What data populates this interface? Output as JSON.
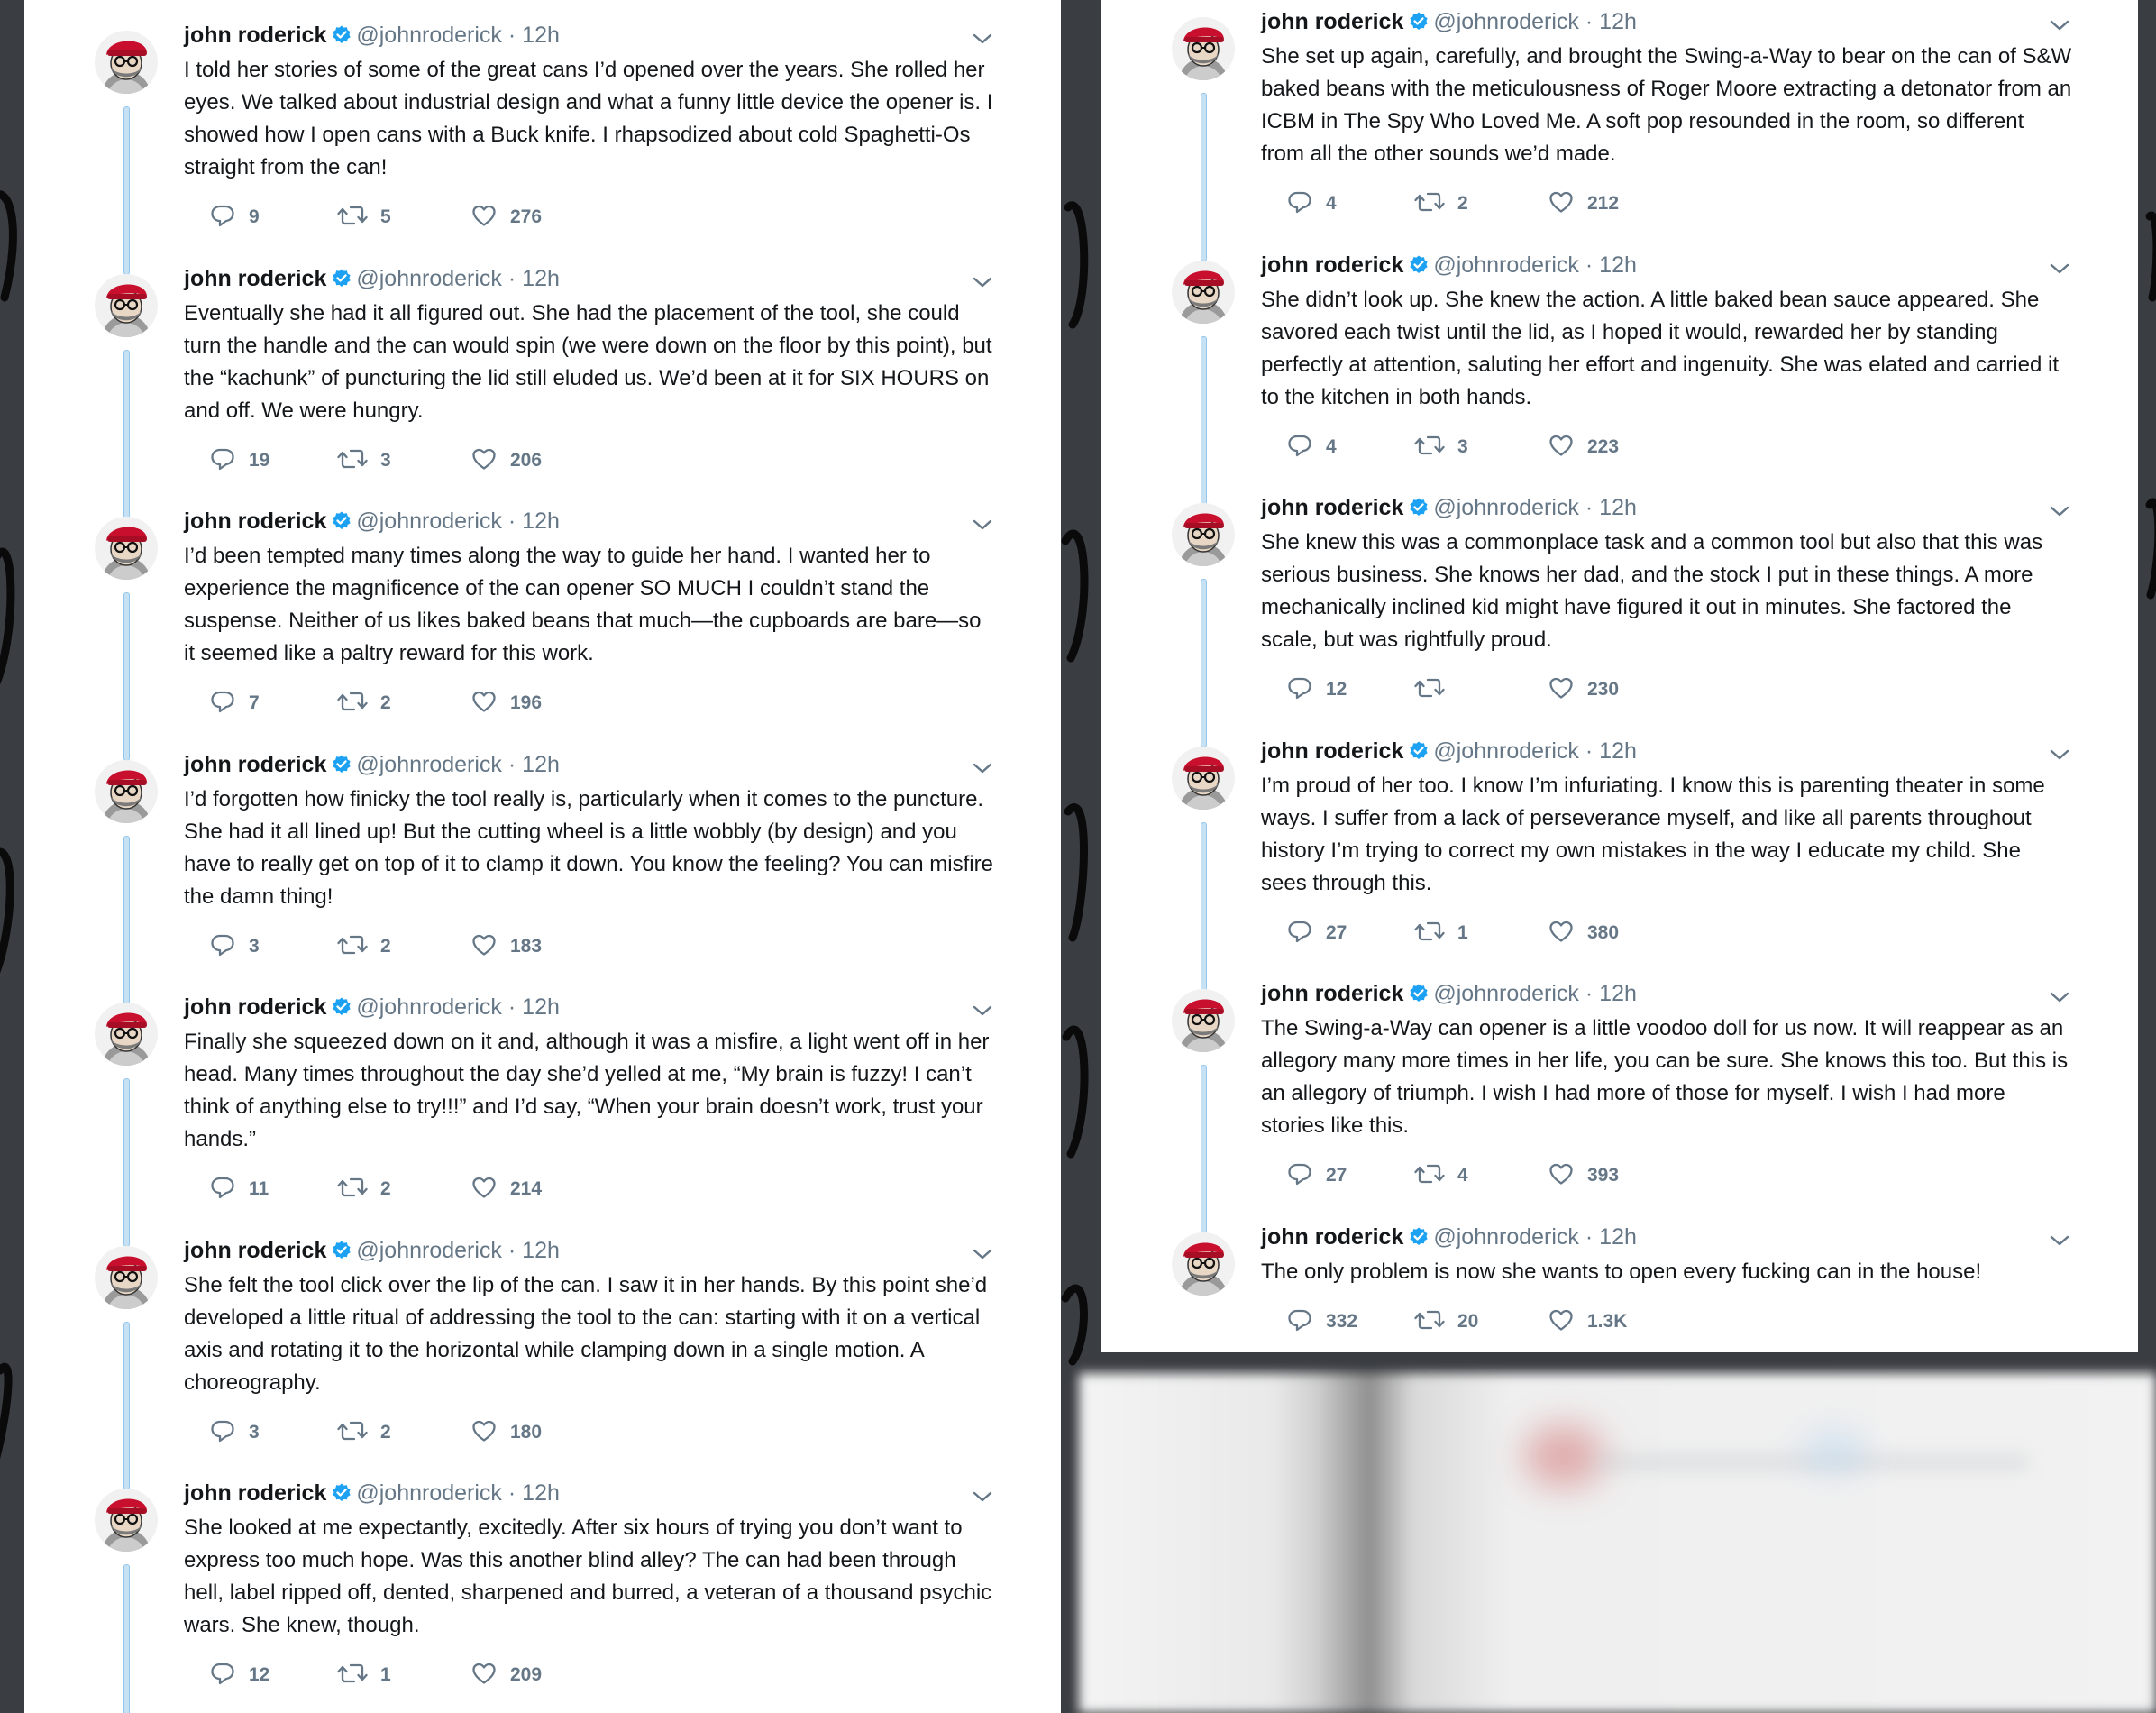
{
  "author": {
    "name": "john roderick",
    "handle": "@johnroderick",
    "separator": "·",
    "time": "12h"
  },
  "colors": {
    "thread_line": "#c7e1f4",
    "verified": "#1da1f2",
    "meta_text": "#657786",
    "body_text": "#14171a",
    "avatar_hat": "#c8102e"
  },
  "icons": [
    "verified-badge-icon",
    "chevron-down-icon",
    "reply-icon",
    "retweet-icon",
    "like-icon"
  ],
  "left_column": [
    {
      "text": "I told her stories of some of the great cans I’d opened over the years. She rolled her eyes. We talked about industrial design and what a funny little device the opener is. I showed how I open cans with a Buck knife. I rhapsodized about cold Spaghetti-Os straight from the can!",
      "replies": "9",
      "retweets": "5",
      "likes": "276"
    },
    {
      "text": "Eventually she had it all figured out. She had the placement of the tool, she could turn the handle and the can would spin (we were down on the floor by this point), but the “kachunk” of puncturing the lid still eluded us. We’d been at it for SIX HOURS on and off. We were hungry.",
      "replies": "19",
      "retweets": "3",
      "likes": "206"
    },
    {
      "text": "I’d been tempted many times along the way to guide her hand. I wanted her to experience the magnificence of the can opener SO MUCH I couldn’t stand the suspense. Neither of us likes baked beans that much—the cupboards are bare—so it seemed like a paltry reward for this work.",
      "replies": "7",
      "retweets": "2",
      "likes": "196"
    },
    {
      "text": "I’d forgotten how finicky the tool really is, particularly when it comes to the puncture. She had it all lined up! But the cutting wheel is a little wobbly (by design) and you have to really get on top of it to clamp it down. You know the feeling? You can misfire the damn thing!",
      "replies": "3",
      "retweets": "2",
      "likes": "183"
    },
    {
      "text": "Finally she squeezed down on it and, although it was a misfire, a light went off in her head. Many times throughout the day she’d yelled at me, “My brain is fuzzy! I can’t think of anything else to try!!!” and I’d say, “When your brain doesn’t work, trust your hands.”",
      "replies": "11",
      "retweets": "2",
      "likes": "214"
    },
    {
      "text": "She felt the tool click over the lip of the can. I saw it in her hands. By this point she’d developed a little ritual of addressing the tool to the can: starting with it on a vertical axis and rotating it to the horizontal while clamping down in a single motion. A choreography.",
      "replies": "3",
      "retweets": "2",
      "likes": "180"
    },
    {
      "text": "She looked at me expectantly, excitedly. After six hours of trying you don’t want to express too much hope. Was this another blind alley? The can had been through hell, label ripped off, dented, sharpened and burred, a veteran of a thousand psychic wars. She knew, though.",
      "replies": "12",
      "retweets": "1",
      "likes": "209"
    }
  ],
  "right_column": [
    {
      "text": "She set up again, carefully, and brought the Swing-a-Way to bear on the can of S&W baked beans with the meticulousness of Roger Moore extracting a detonator from an ICBM in The Spy Who Loved Me. A soft pop resounded in the room, so different from all the other sounds we’d made.",
      "replies": "4",
      "retweets": "2",
      "likes": "212"
    },
    {
      "text": "She didn’t look up. She knew the action. A little baked bean sauce appeared. She savored each twist until the lid, as I hoped it would, rewarded her by standing perfectly at attention, saluting her effort and ingenuity. She was elated and carried it to the kitchen in both hands.",
      "replies": "4",
      "retweets": "3",
      "likes": "223"
    },
    {
      "text": "She knew this was a commonplace task and a common tool but also that this was serious business. She knows her dad, and the stock I put in these things. A more mechanically inclined kid might have figured it out in minutes. She factored the scale, but was rightfully proud.",
      "replies": "12",
      "retweets": "",
      "likes": "230"
    },
    {
      "text": "I’m proud of her too. I know I’m infuriating. I know this is parenting theater in some ways. I suffer from a lack of perseverance myself, and like all parents throughout history I’m trying to correct my own mistakes in the way I educate my child. She sees through this.",
      "replies": "27",
      "retweets": "1",
      "likes": "380"
    },
    {
      "text": "The Swing-a-Way can opener is a little voodoo doll for us now. It will reappear as an allegory many more times in her life, you can be sure. She knows this too. But this is an allegory of triumph. I wish I had more of those for myself. I wish I had more stories like this.",
      "replies": "27",
      "retweets": "4",
      "likes": "393"
    },
    {
      "text": "The only problem is now she wants to open every fucking can in the house!",
      "replies": "332",
      "retweets": "20",
      "likes": "1.3K"
    }
  ]
}
